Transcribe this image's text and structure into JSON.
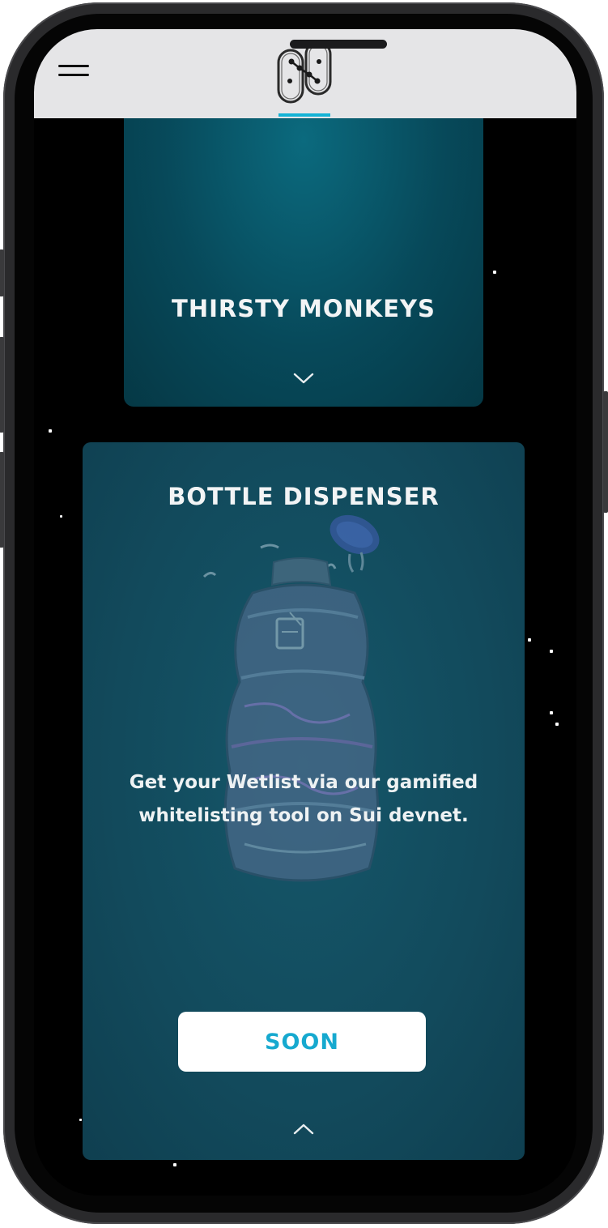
{
  "header": {
    "menu_icon": "hamburger-menu-icon",
    "logo_icon": "circuit-h-logo",
    "accent_color": "#14b3d6"
  },
  "cards": {
    "thirsty": {
      "title": "THIRSTY MONKEYS",
      "toggle_icon": "chevron-down-icon"
    },
    "bottle": {
      "title": "BOTTLE DISPENSER",
      "description_line1": "Get your Wetlist via our gamified",
      "description_line2": "whitelisting tool on Sui devnet.",
      "button_label": "SOON",
      "toggle_icon": "chevron-up-icon",
      "art": "water-bottle-illustration"
    }
  },
  "colors": {
    "card_teal": "#07495a",
    "card_bottle": "#124a5c",
    "button_text": "#16a9cf"
  }
}
